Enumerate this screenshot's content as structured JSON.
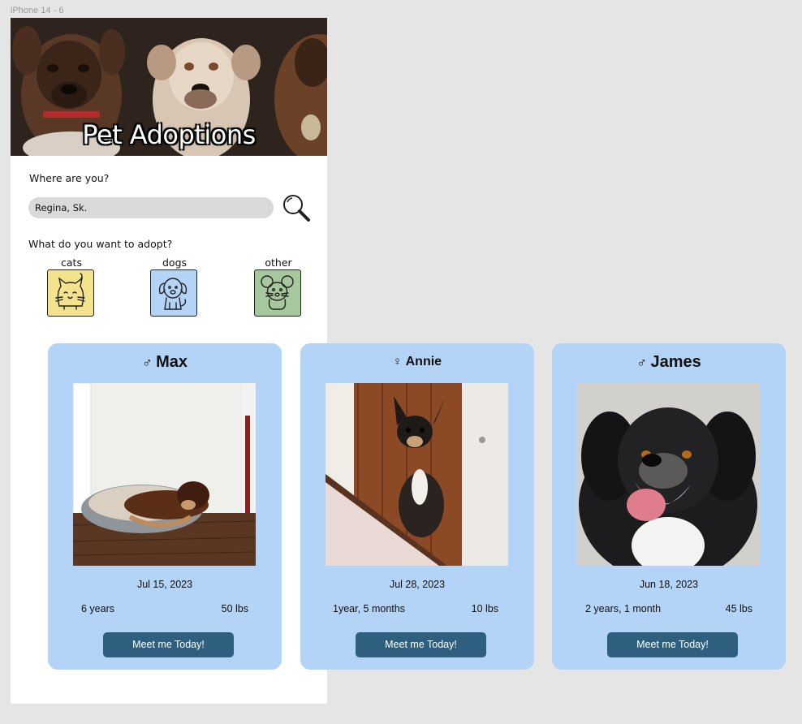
{
  "frame": {
    "label": "iPhone 14 - 6"
  },
  "hero": {
    "title": "Pet Adoptions"
  },
  "location": {
    "question": "Where are you?",
    "value": "Regina, Sk."
  },
  "adopt": {
    "question": "What do you want to adopt?",
    "categories": [
      {
        "label": "cats",
        "color": "#f3e38c",
        "icon": "cat-icon"
      },
      {
        "label": "dogs",
        "color": "#b3d3f7",
        "icon": "dog-icon"
      },
      {
        "label": "other",
        "color": "#a7c79c",
        "icon": "mouse-icon"
      }
    ]
  },
  "pets": [
    {
      "sex_symbol": "♂",
      "name": "Max",
      "date": "Jul 15, 2023",
      "age": "6 years",
      "weight": "50 lbs",
      "button": "Meet me Today!"
    },
    {
      "sex_symbol": "♀",
      "name": "Annie",
      "date": "Jul 28, 2023",
      "age": "1year, 5 months",
      "weight": "10 lbs",
      "button": "Meet me Today!"
    },
    {
      "sex_symbol": "♂",
      "name": "James",
      "date": "Jun 18, 2023",
      "age": "2 years, 1 month",
      "weight": "45 lbs",
      "button": "Meet me Today!"
    }
  ]
}
